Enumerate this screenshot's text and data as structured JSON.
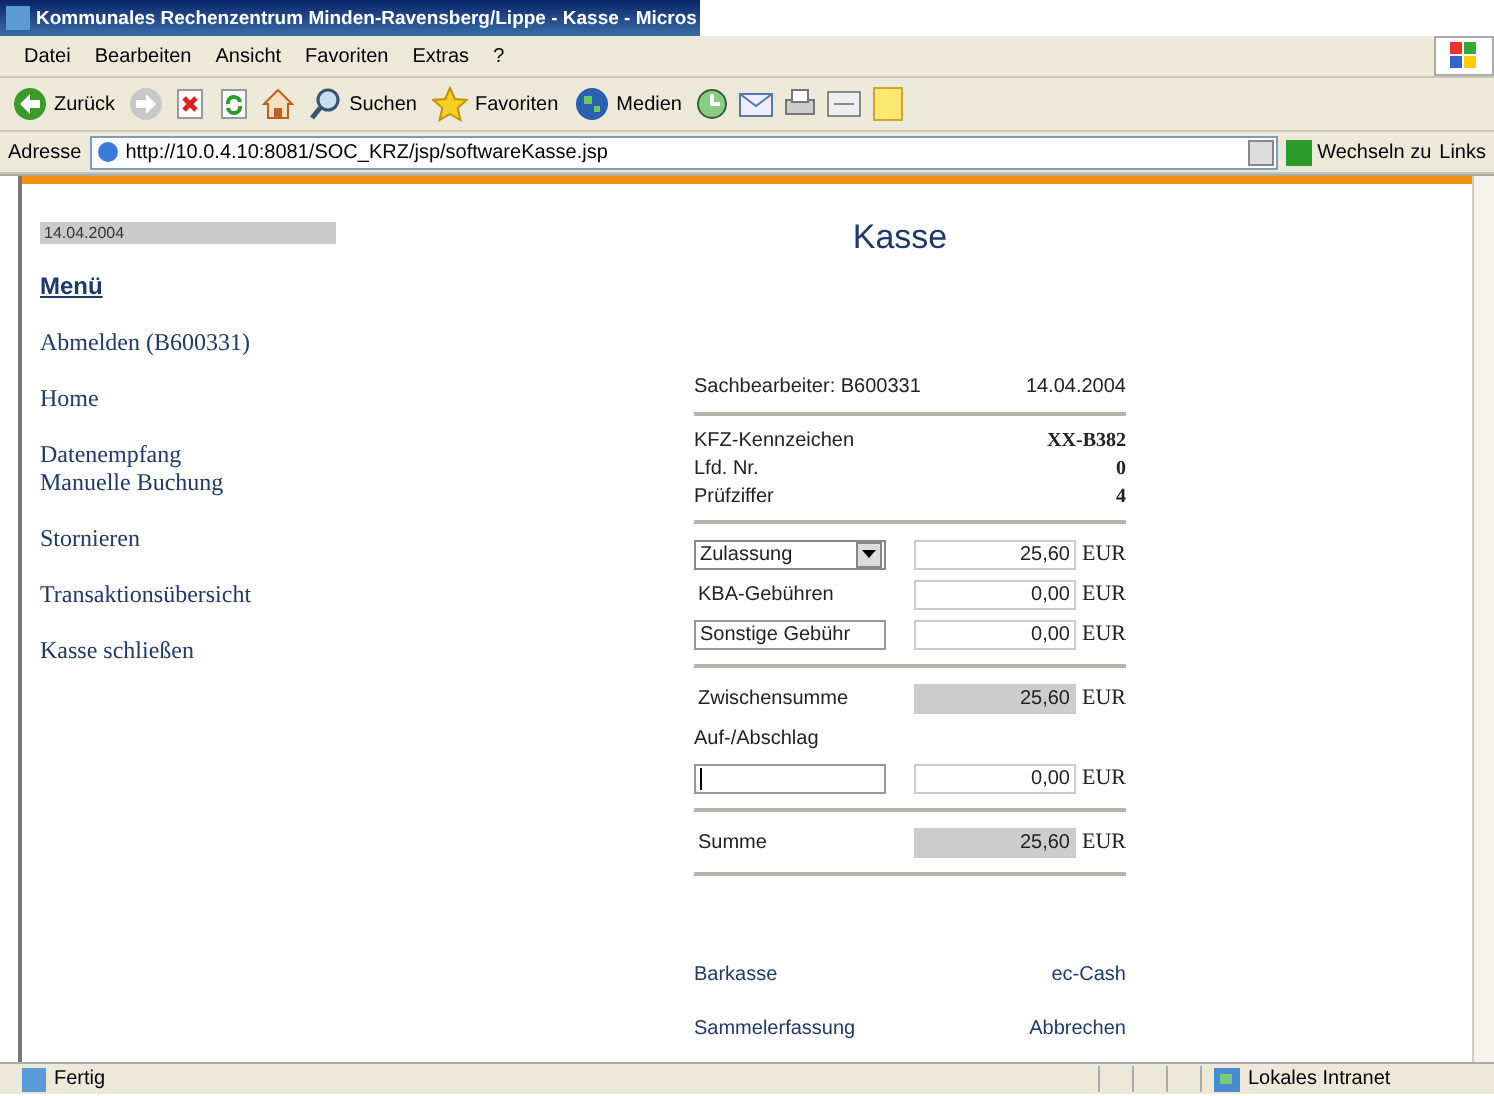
{
  "window": {
    "title": "Kommunales Rechenzentrum Minden-Ravensberg/Lippe - Kasse - Micros"
  },
  "menu": [
    "Datei",
    "Bearbeiten",
    "Ansicht",
    "Favoriten",
    "Extras",
    "?"
  ],
  "toolbar": [
    {
      "kind": "back",
      "label": "Zurück"
    },
    {
      "kind": "forward"
    },
    {
      "kind": "stop"
    },
    {
      "kind": "refresh"
    },
    {
      "kind": "home"
    },
    {
      "kind": "search",
      "label": "Suchen"
    },
    {
      "kind": "favorites",
      "label": "Favoriten"
    },
    {
      "kind": "media",
      "label": "Medien"
    },
    {
      "kind": "history"
    },
    {
      "kind": "mail"
    },
    {
      "kind": "print"
    },
    {
      "kind": "edit"
    },
    {
      "kind": "note"
    }
  ],
  "address": {
    "label": "Adresse",
    "url": "http://10.0.4.10:8081/SOC_KRZ/jsp/softwareKasse.jsp",
    "go": "Wechseln zu",
    "links": "Links"
  },
  "sidebar": {
    "date": "14.04.2004",
    "heading": "Menü",
    "groups": [
      [
        "Abmelden (B600331)"
      ],
      [
        "Home"
      ],
      [
        "Datenempfang",
        "Manuelle Buchung"
      ],
      [
        "Stornieren"
      ],
      [
        "Transaktionsübersicht"
      ],
      [
        "Kasse schließen"
      ]
    ]
  },
  "main": {
    "title": "Kasse",
    "clerk": "Sachbearbeiter: B600331",
    "date": "14.04.2004",
    "vehicle": [
      {
        "label": "KFZ-Kennzeichen",
        "value": "XX-B382"
      },
      {
        "label": "Lfd. Nr.",
        "value": "0"
      },
      {
        "label": "Prüfziffer",
        "value": "4"
      }
    ],
    "fees": [
      {
        "kind": "select",
        "label": "Zulassung",
        "amount": "25,60",
        "unit": "EUR"
      },
      {
        "kind": "text",
        "label": "KBA-Gebühren",
        "amount": "0,00",
        "unit": "EUR"
      },
      {
        "kind": "input",
        "label": "Sonstige Gebühr",
        "amount": "0,00",
        "unit": "EUR"
      }
    ],
    "subtotal": {
      "label": "Zwischensumme",
      "amount": "25,60",
      "unit": "EUR"
    },
    "surcharge": {
      "label": "Auf-/Abschlag",
      "amount": "0,00",
      "unit": "EUR"
    },
    "total": {
      "label": "Summe",
      "amount": "25,60",
      "unit": "EUR"
    },
    "actions": [
      [
        "Barkasse",
        "ec-Cash"
      ],
      [
        "Sammelerfassung",
        "Abbrechen"
      ]
    ]
  },
  "status": {
    "text": "Fertig",
    "zone": "Lokales Intranet"
  }
}
